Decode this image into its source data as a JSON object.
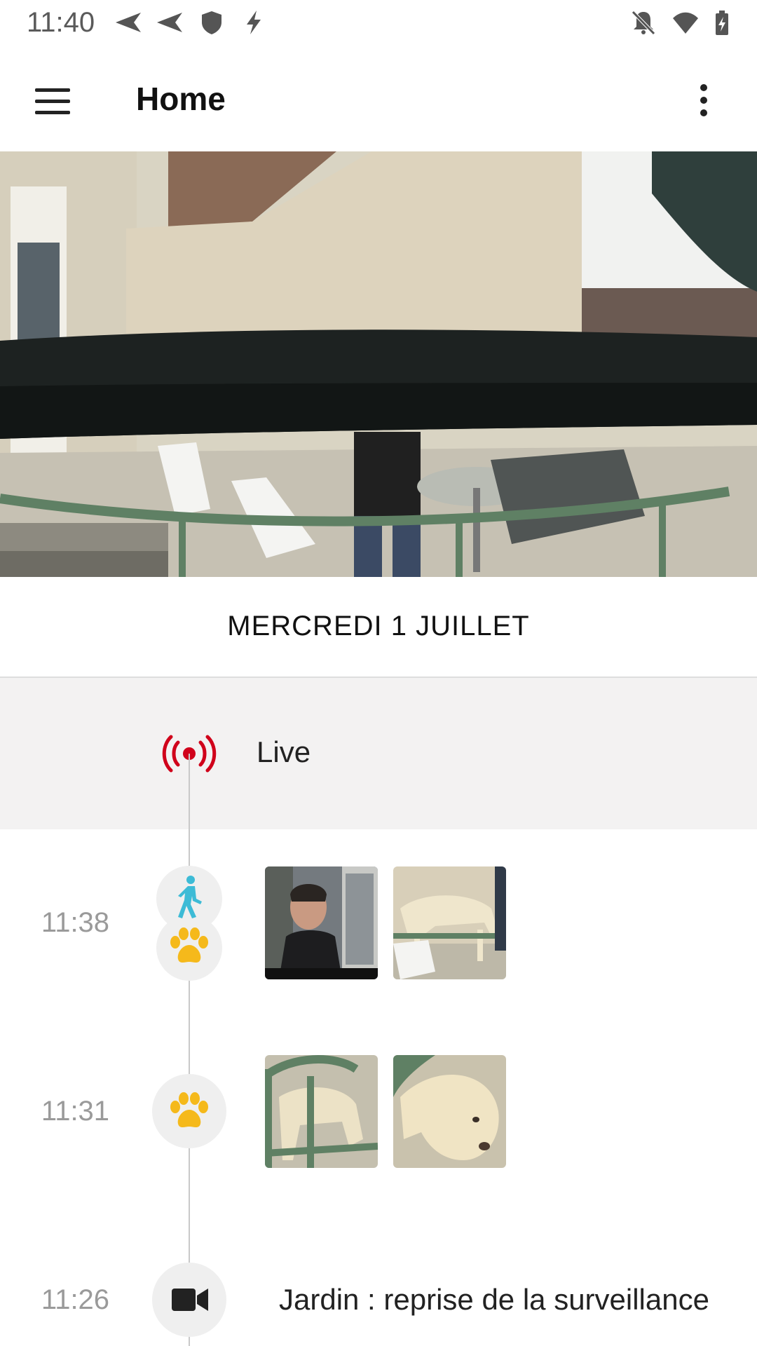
{
  "status_bar": {
    "time": "11:40"
  },
  "app_bar": {
    "title": "Home"
  },
  "date_header": "MERCREDI 1 JUILLET",
  "live": {
    "label": "Live",
    "color": "#d0021b"
  },
  "events": [
    {
      "time": "11:38",
      "icons": [
        "person-walking-icon",
        "paw-icon"
      ]
    },
    {
      "time": "11:31",
      "icons": [
        "paw-icon"
      ]
    },
    {
      "time": "11:26",
      "icons": [
        "video-camera-icon"
      ],
      "text": "Jardin : reprise de la surveillance"
    }
  ],
  "colors": {
    "person": "#3dbbd6",
    "paw": "#f5b91b",
    "live": "#d0021b"
  }
}
